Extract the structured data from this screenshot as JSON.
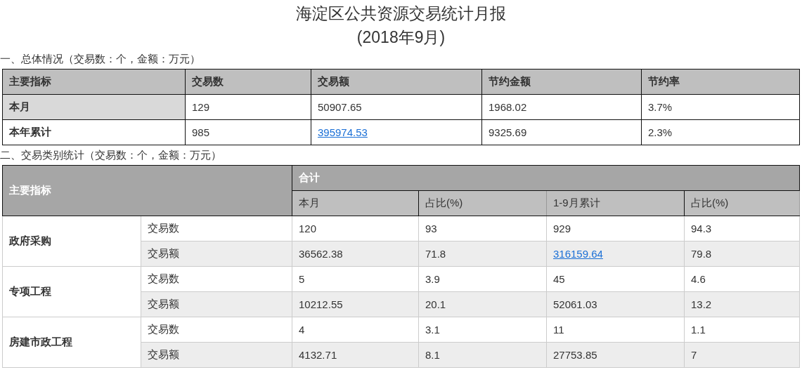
{
  "title": {
    "line_1": "海淀区公共资源交易统计月报",
    "line_2": "(2018年9月)"
  },
  "summary": {
    "caption": "一、总体情况（交易数：个，金额：万元）",
    "columns": [
      "主要指标",
      "交易数",
      "交易额",
      "节约金额",
      "节约率"
    ],
    "rows": [
      {
        "highlighted": true,
        "cells": [
          {
            "text": "本月",
            "kind": "row_header"
          },
          {
            "text": "129",
            "kind": "plain"
          },
          {
            "text": "50907.65",
            "kind": "plain"
          },
          {
            "text": "1968.02",
            "kind": "plain"
          },
          {
            "text": "3.7%",
            "kind": "plain"
          }
        ]
      },
      {
        "highlighted": false,
        "cells": [
          {
            "text": "本年累计",
            "kind": "row_header"
          },
          {
            "text": "985",
            "kind": "plain"
          },
          {
            "text": "395974.53",
            "kind": "link"
          },
          {
            "text": "9325.69",
            "kind": "plain"
          },
          {
            "text": "2.3%",
            "kind": "plain"
          }
        ]
      }
    ]
  },
  "categories": {
    "caption": "二、交易类别统计（交易数：个，金额：万元）",
    "corner": "主要指标",
    "group_header": "合计",
    "columns": [
      "本月",
      "占比(%)",
      "1-9月累计",
      "占比(%)"
    ],
    "groups": [
      {
        "name": "政府采购",
        "rows": [
          {
            "label": "交易数",
            "cells": [
              {
                "text": "120",
                "kind": "plain"
              },
              {
                "text": "93",
                "kind": "plain"
              },
              {
                "text": "929",
                "kind": "plain"
              },
              {
                "text": "94.3",
                "kind": "plain"
              }
            ]
          },
          {
            "label": "交易额",
            "cells": [
              {
                "text": "36562.38",
                "kind": "plain"
              },
              {
                "text": "71.8",
                "kind": "plain"
              },
              {
                "text": "316159.64",
                "kind": "link"
              },
              {
                "text": "79.8",
                "kind": "plain"
              }
            ]
          }
        ]
      },
      {
        "name": "专项工程",
        "rows": [
          {
            "label": "交易数",
            "cells": [
              {
                "text": "5",
                "kind": "plain"
              },
              {
                "text": "3.9",
                "kind": "plain"
              },
              {
                "text": "45",
                "kind": "plain"
              },
              {
                "text": "4.6",
                "kind": "plain"
              }
            ]
          },
          {
            "label": "交易额",
            "cells": [
              {
                "text": "10212.55",
                "kind": "plain"
              },
              {
                "text": "20.1",
                "kind": "plain"
              },
              {
                "text": "52061.03",
                "kind": "plain"
              },
              {
                "text": "13.2",
                "kind": "plain"
              }
            ]
          }
        ]
      },
      {
        "name": "房建市政工程",
        "rows": [
          {
            "label": "交易数",
            "cells": [
              {
                "text": "4",
                "kind": "plain"
              },
              {
                "text": "3.1",
                "kind": "plain"
              },
              {
                "text": "11",
                "kind": "plain"
              },
              {
                "text": "1.1",
                "kind": "plain"
              }
            ]
          },
          {
            "label": "交易额",
            "cells": [
              {
                "text": "4132.71",
                "kind": "plain"
              },
              {
                "text": "8.1",
                "kind": "plain"
              },
              {
                "text": "27753.85",
                "kind": "plain"
              },
              {
                "text": "7",
                "kind": "plain"
              }
            ]
          }
        ]
      }
    ]
  }
}
